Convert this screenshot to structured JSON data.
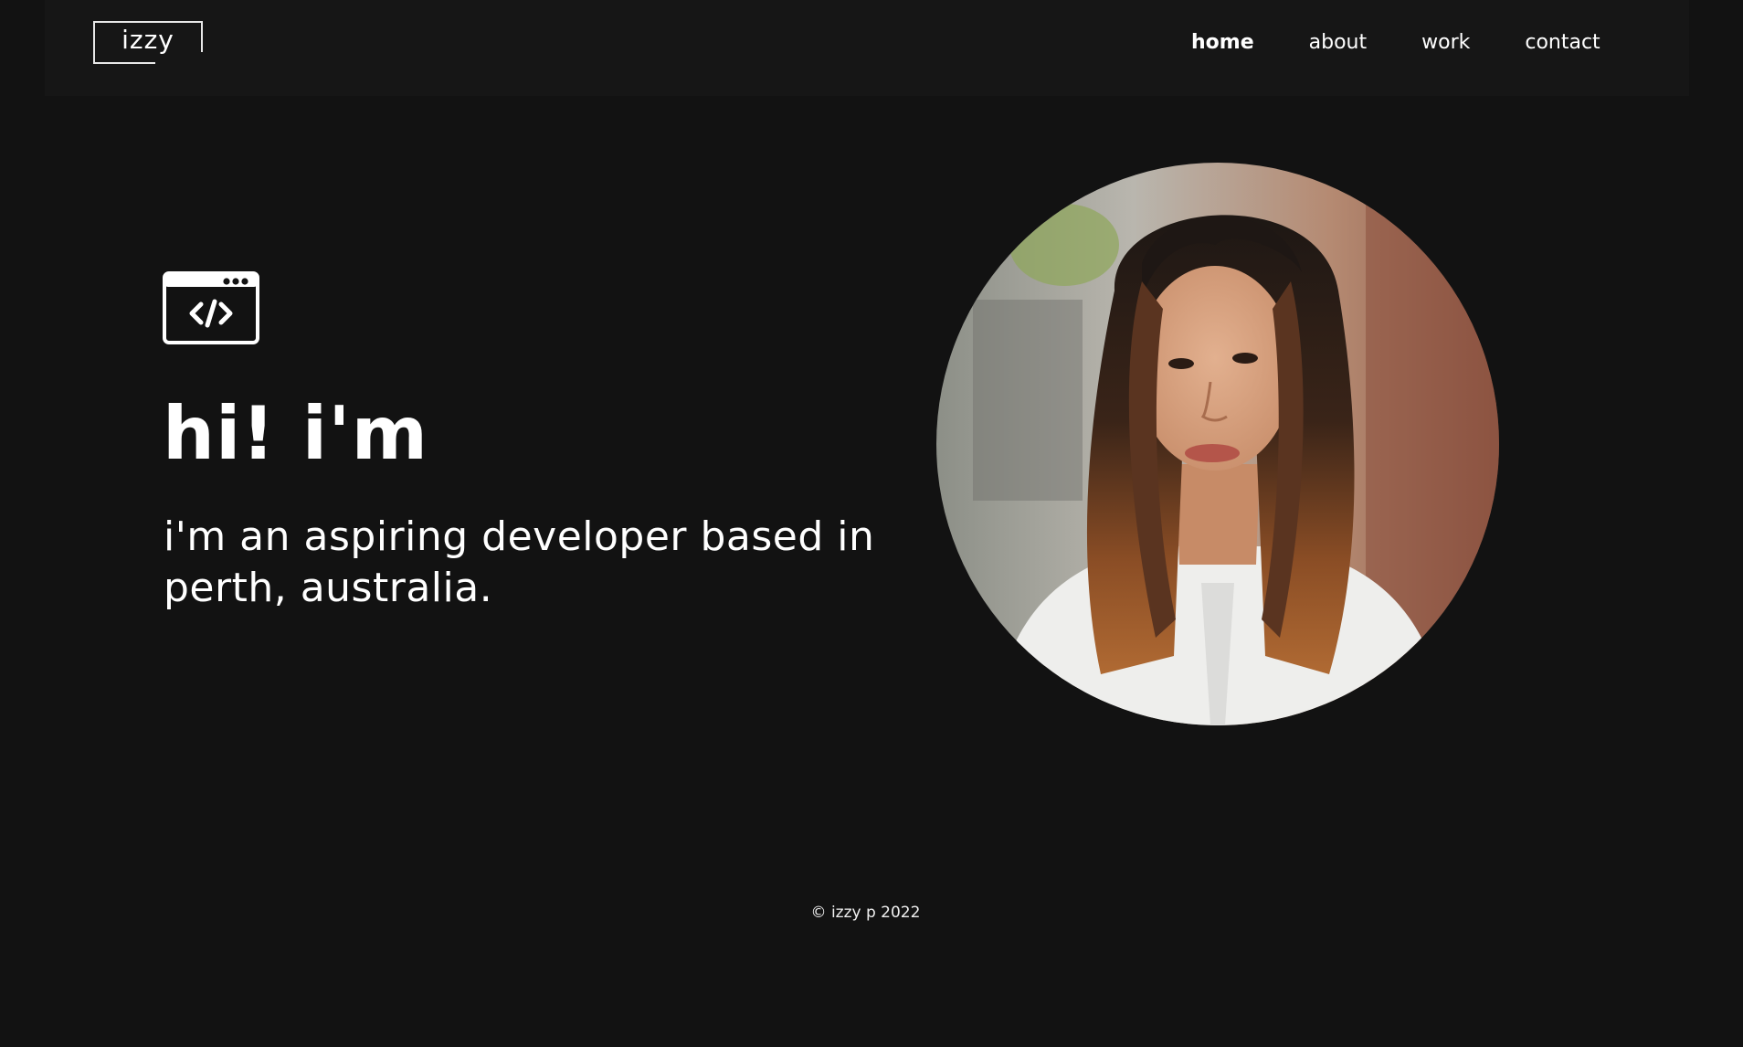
{
  "header": {
    "logo_text": "izzy",
    "nav": [
      {
        "label": "home",
        "active": true
      },
      {
        "label": "about",
        "active": false
      },
      {
        "label": "work",
        "active": false
      },
      {
        "label": "contact",
        "active": false
      }
    ]
  },
  "hero": {
    "icon": "code-window-icon",
    "title": "hi! i'm",
    "subtitle": "i'm an aspiring developer based in perth, australia."
  },
  "portrait": {
    "icon": "profile-photo"
  },
  "footer": {
    "copyright": "© izzy p 2022"
  },
  "colors": {
    "background": "#121212",
    "header_background": "#161616",
    "text": "#ffffff"
  }
}
